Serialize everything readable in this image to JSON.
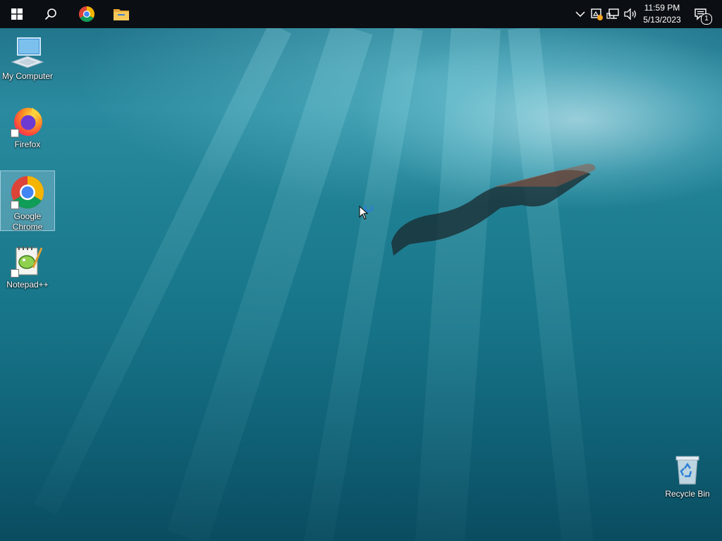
{
  "taskbar": {
    "pinned": [
      {
        "name": "start-button",
        "icon": "windows-logo-icon"
      },
      {
        "name": "search-button",
        "icon": "search-icon"
      },
      {
        "name": "chrome-taskbar-button",
        "icon": "chrome-icon"
      },
      {
        "name": "file-explorer-taskbar-button",
        "icon": "folder-icon"
      }
    ],
    "tray": {
      "icons": [
        "chevron-up-icon",
        "security-warning-icon",
        "network-icon",
        "volume-icon"
      ],
      "time": "11:59 PM",
      "date": "5/13/2023",
      "notification_count": "1"
    }
  },
  "desktop": {
    "icons": [
      {
        "label": "My Computer",
        "icon": "computer-icon",
        "selected": false
      },
      {
        "label": "Firefox",
        "icon": "firefox-icon",
        "selected": false
      },
      {
        "label": "Google Chrome",
        "icon": "chrome-icon",
        "selected": true
      },
      {
        "label": "Notepad++",
        "icon": "notepadpp-icon",
        "selected": false
      },
      {
        "label": "Recycle Bin",
        "icon": "recycle-bin-icon",
        "selected": false
      }
    ]
  },
  "colors": {
    "taskbar": "#0b0f14",
    "selection": "#aad2e6"
  }
}
